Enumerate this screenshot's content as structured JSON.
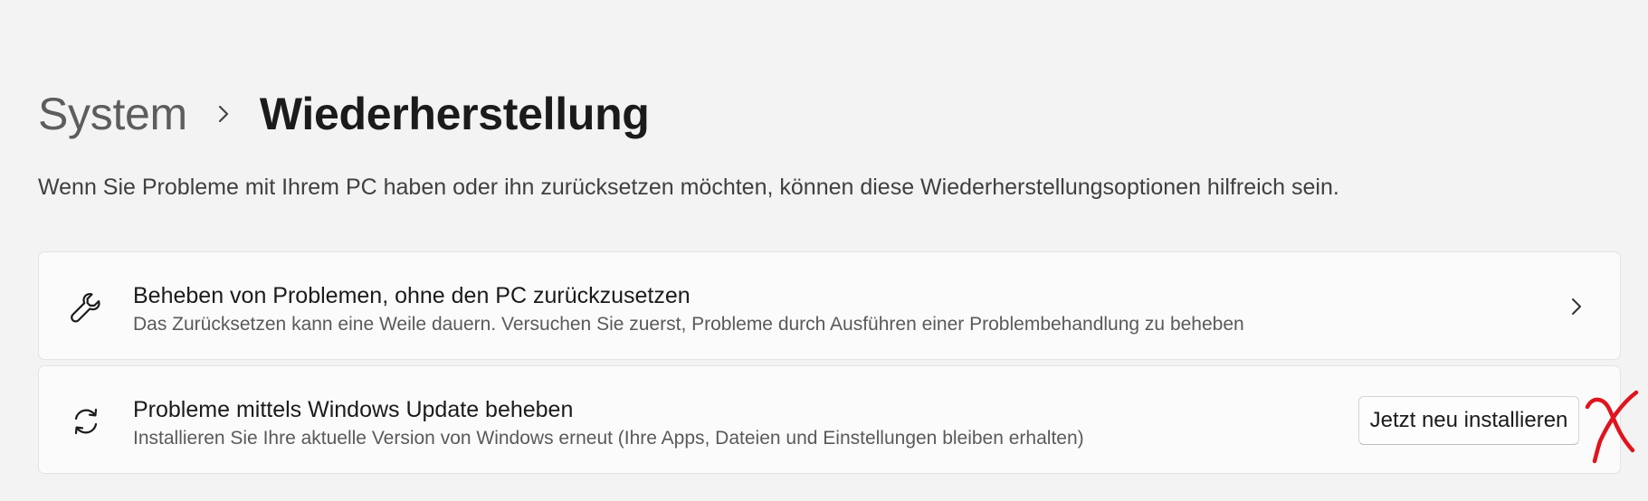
{
  "breadcrumb": {
    "parent": "System",
    "separator_icon": "chevron-right-icon",
    "current": "Wiederherstellung"
  },
  "description": "Wenn Sie Probleme mit Ihrem PC haben oder ihn zurücksetzen möchten, können diese Wiederherstellungsoptionen hilfreich sein.",
  "options": [
    {
      "icon": "wrench-icon",
      "title": "Beheben von Problemen, ohne den PC zurückzusetzen",
      "subtitle": "Das Zurücksetzen kann eine Weile dauern. Versuchen Sie zuerst, Probleme durch Ausführen einer Problembehandlung zu beheben",
      "action_icon": "chevron-right-icon"
    },
    {
      "icon": "refresh-icon",
      "title": "Probleme mittels Windows Update beheben",
      "subtitle": "Installieren Sie Ihre aktuelle Version von Windows erneut (Ihre Apps, Dateien und Einstellungen bleiben erhalten)",
      "button_label": "Jetzt neu installieren"
    }
  ],
  "annotation": {
    "icon": "red-handwritten-x-mark",
    "color": "#e0141e"
  },
  "colors": {
    "background": "#f3f3f3",
    "card": "#fbfbfb",
    "card_border": "#e3e3e3",
    "text_primary": "#1b1b1b",
    "text_secondary": "#5a5a5a"
  }
}
